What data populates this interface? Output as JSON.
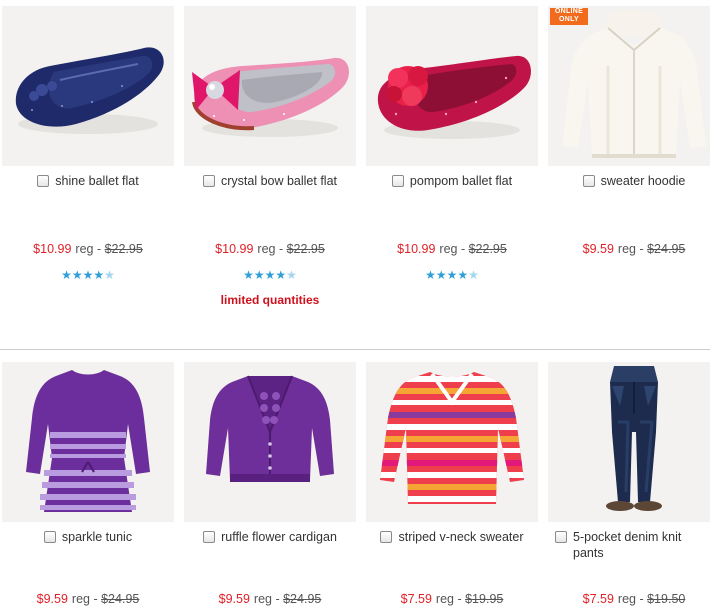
{
  "badge": {
    "line1": "ONLINE",
    "line2": "ONLY"
  },
  "products": [
    {
      "name": "shine ballet flat",
      "sale": "$10.99",
      "reg_label": "reg -",
      "was": "$22.95",
      "stars": [
        "★",
        "★",
        "★",
        "★",
        "★"
      ],
      "rating": 4,
      "note": ""
    },
    {
      "name": "crystal bow ballet flat",
      "sale": "$10.99",
      "reg_label": "reg -",
      "was": "$22.95",
      "stars": [
        "★",
        "★",
        "★",
        "★",
        "★"
      ],
      "rating": 4,
      "note": "limited quantities"
    },
    {
      "name": "pompom ballet flat",
      "sale": "$10.99",
      "reg_label": "reg -",
      "was": "$22.95",
      "stars": [
        "★",
        "★",
        "★",
        "★",
        "★"
      ],
      "rating": 4,
      "note": ""
    },
    {
      "name": "sweater hoodie",
      "sale": "$9.59",
      "reg_label": "reg -",
      "was": "$24.95",
      "online_only": true
    },
    {
      "name": "sparkle tunic",
      "sale": "$9.59",
      "reg_label": "reg -",
      "was": "$24.95"
    },
    {
      "name": "ruffle flower cardigan",
      "sale": "$9.59",
      "reg_label": "reg -",
      "was": "$24.95"
    },
    {
      "name": "striped v-neck sweater",
      "sale": "$7.59",
      "reg_label": "reg -",
      "was": "$19.95"
    },
    {
      "name": "5-pocket denim knit pants",
      "sale": "$7.59",
      "reg_label": "reg -",
      "was": "$19.50"
    }
  ],
  "colors": {
    "sale_price": "#e01f26",
    "star_on": "#2f9fd6",
    "star_off": "#a6d5ee",
    "badge": "#f26b1d",
    "note": "#d0111d"
  }
}
